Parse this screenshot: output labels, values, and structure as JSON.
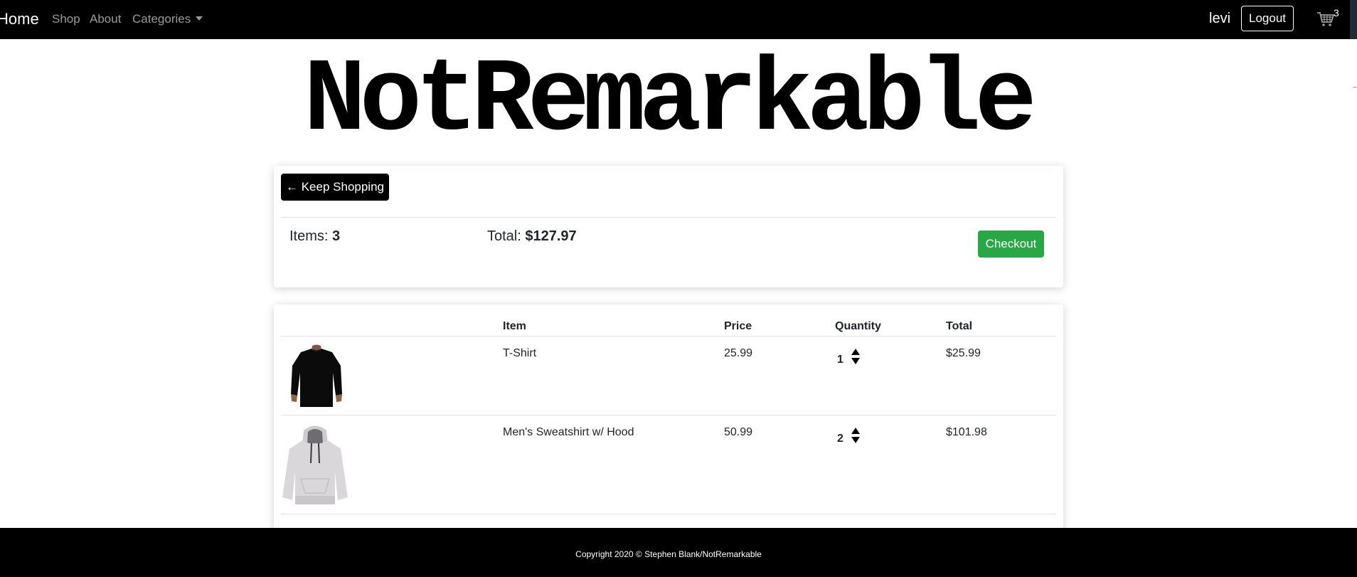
{
  "navbar": {
    "brand": "Home",
    "links": [
      "Shop",
      "About",
      "Categories"
    ],
    "username": "levi",
    "logout_label": "Logout",
    "cart_count": "3"
  },
  "logo": {
    "text": "NotRemarkable"
  },
  "summary": {
    "keep_shopping_label": "← Keep Shopping",
    "items_label": "Items:",
    "items_value": "3",
    "total_label": "Total:",
    "total_value": "$127.97",
    "checkout_label": "Checkout"
  },
  "cart_table": {
    "headers": {
      "item": "Item",
      "price": "Price",
      "quantity": "Quantity",
      "total": "Total"
    },
    "rows": [
      {
        "image": "black-tshirt-image",
        "item": "T-Shirt",
        "price": "25.99",
        "quantity": "1",
        "total": "$25.99"
      },
      {
        "image": "grey-hooded-sweatshirt-image",
        "item": "Men's Sweatshirt w/ Hood",
        "price": "50.99",
        "quantity": "2",
        "total": "$101.98"
      }
    ]
  },
  "footer": {
    "text": "Copyright 2020 © Stephen Blank/NotRemarkable"
  },
  "colors": {
    "navbar_bg": "#000000",
    "checkout_green": "#28a745",
    "keep_shopping_bg": "#000000",
    "footer_bg": "#000000"
  },
  "icons": [
    "shopping-cart-icon",
    "caret-down-icon",
    "arrow-up-icon",
    "arrow-down-icon"
  ]
}
